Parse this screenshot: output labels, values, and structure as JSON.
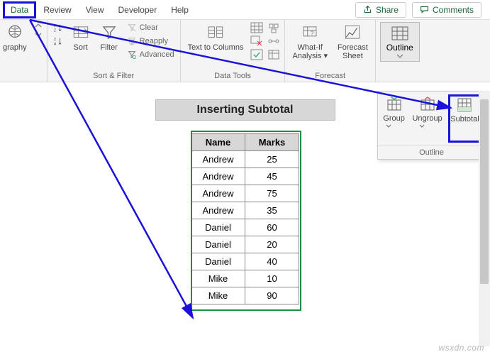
{
  "tabs": {
    "data": "Data",
    "review": "Review",
    "view": "View",
    "developer": "Developer",
    "help": "Help"
  },
  "topright": {
    "share": "Share",
    "comments": "Comments"
  },
  "ribbon": {
    "geography": {
      "label": "graphy"
    },
    "sort_filter": {
      "az": "A→Z",
      "za": "Z→A",
      "sort": "Sort",
      "filter": "Filter",
      "clear": "Clear",
      "reapply": "Reapply",
      "advanced": "Advanced",
      "group_label": "Sort & Filter"
    },
    "data_tools": {
      "text_to_columns": "Text to Columns",
      "group_label": "Data Tools"
    },
    "forecast": {
      "whatif": "What-If Analysis",
      "forecast_sheet": "Forecast Sheet",
      "group_label": "Forecast"
    },
    "outline": {
      "label": "Outline"
    }
  },
  "flyout": {
    "group": "Group",
    "ungroup": "Ungroup",
    "subtotal": "Subtotal",
    "label": "Outline"
  },
  "sheet": {
    "title": "Inserting Subtotal",
    "headers": {
      "name": "Name",
      "marks": "Marks"
    },
    "rows": [
      {
        "name": "Andrew",
        "marks": "25"
      },
      {
        "name": "Andrew",
        "marks": "45"
      },
      {
        "name": "Andrew",
        "marks": "75"
      },
      {
        "name": "Andrew",
        "marks": "35"
      },
      {
        "name": "Daniel",
        "marks": "60"
      },
      {
        "name": "Daniel",
        "marks": "20"
      },
      {
        "name": "Daniel",
        "marks": "40"
      },
      {
        "name": "Mike",
        "marks": "10"
      },
      {
        "name": "Mike",
        "marks": "90"
      }
    ]
  },
  "watermark": "wsxdn.com"
}
